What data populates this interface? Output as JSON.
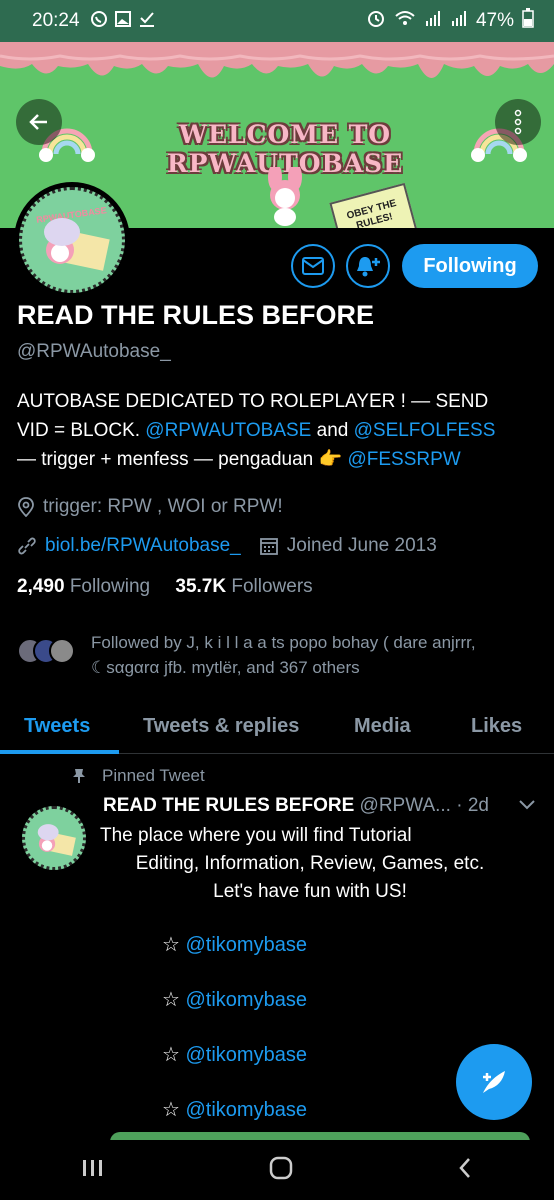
{
  "status_bar": {
    "time": "20:24",
    "battery": "47%",
    "left_icons": [
      "whatsapp-icon",
      "gallery-icon",
      "check-icon"
    ],
    "right_icons": [
      "alarm-icon",
      "wifi-icon",
      "signal-icon",
      "signal-icon",
      "battery-icon"
    ]
  },
  "banner": {
    "title": "WELCOME TO RPWAUTOBASE",
    "sign_text": "OBEY THE RULES!"
  },
  "avatar": {
    "text": "RPWAUTOBASE"
  },
  "profile": {
    "name": "READ THE RULES BEFORE",
    "handle": "@RPWAutobase_",
    "bio_line1": "AUTOBASE DEDICATED TO ROLEPLAYER ! — SEND",
    "bio_line2_a": "VID = BLOCK. ",
    "bio_mention1": "@RPWAUTOBASE",
    "bio_line2_b": " and ",
    "bio_mention2": "@SELFOLFESS",
    "bio_line3_a": "— trigger + menfess — pengaduan 👉 ",
    "bio_mention3": "@FESSRPW",
    "location": "trigger: RPW , WOI or RPW!",
    "website": "biol.be/RPWAutobase_",
    "joined": "Joined June 2013",
    "following_count": "2,490",
    "following_label": "Following",
    "followers_count": "35.7K",
    "followers_label": "Followers",
    "followed_by": "Followed by J, k i l l a a ts popo bohay ( dare anjrrr, ☾sαgαrα jfb. mytlër, and 367 others",
    "follow_button": "Following"
  },
  "tabs": [
    "Tweets",
    "Tweets & replies",
    "Media",
    "Likes"
  ],
  "tweet": {
    "pinned_label": "Pinned Tweet",
    "author": "READ THE RULES BEFORE",
    "handle": "@RPWA...",
    "time": "· 2d",
    "line1": "The place where you will find Tutorial",
    "line2": "Editing, Information, Review, Games, etc.",
    "line3": "Let's have fun with US!",
    "star_prefix": "☆ ",
    "mentions": [
      "@tikomybase",
      "@tikomybase",
      "@tikomybase",
      "@tikomybase"
    ]
  },
  "colors": {
    "accent": "#1d9bf0",
    "banner_green": "#5fc569",
    "banner_pink": "#e69aa2",
    "muted": "#8b98a5"
  }
}
